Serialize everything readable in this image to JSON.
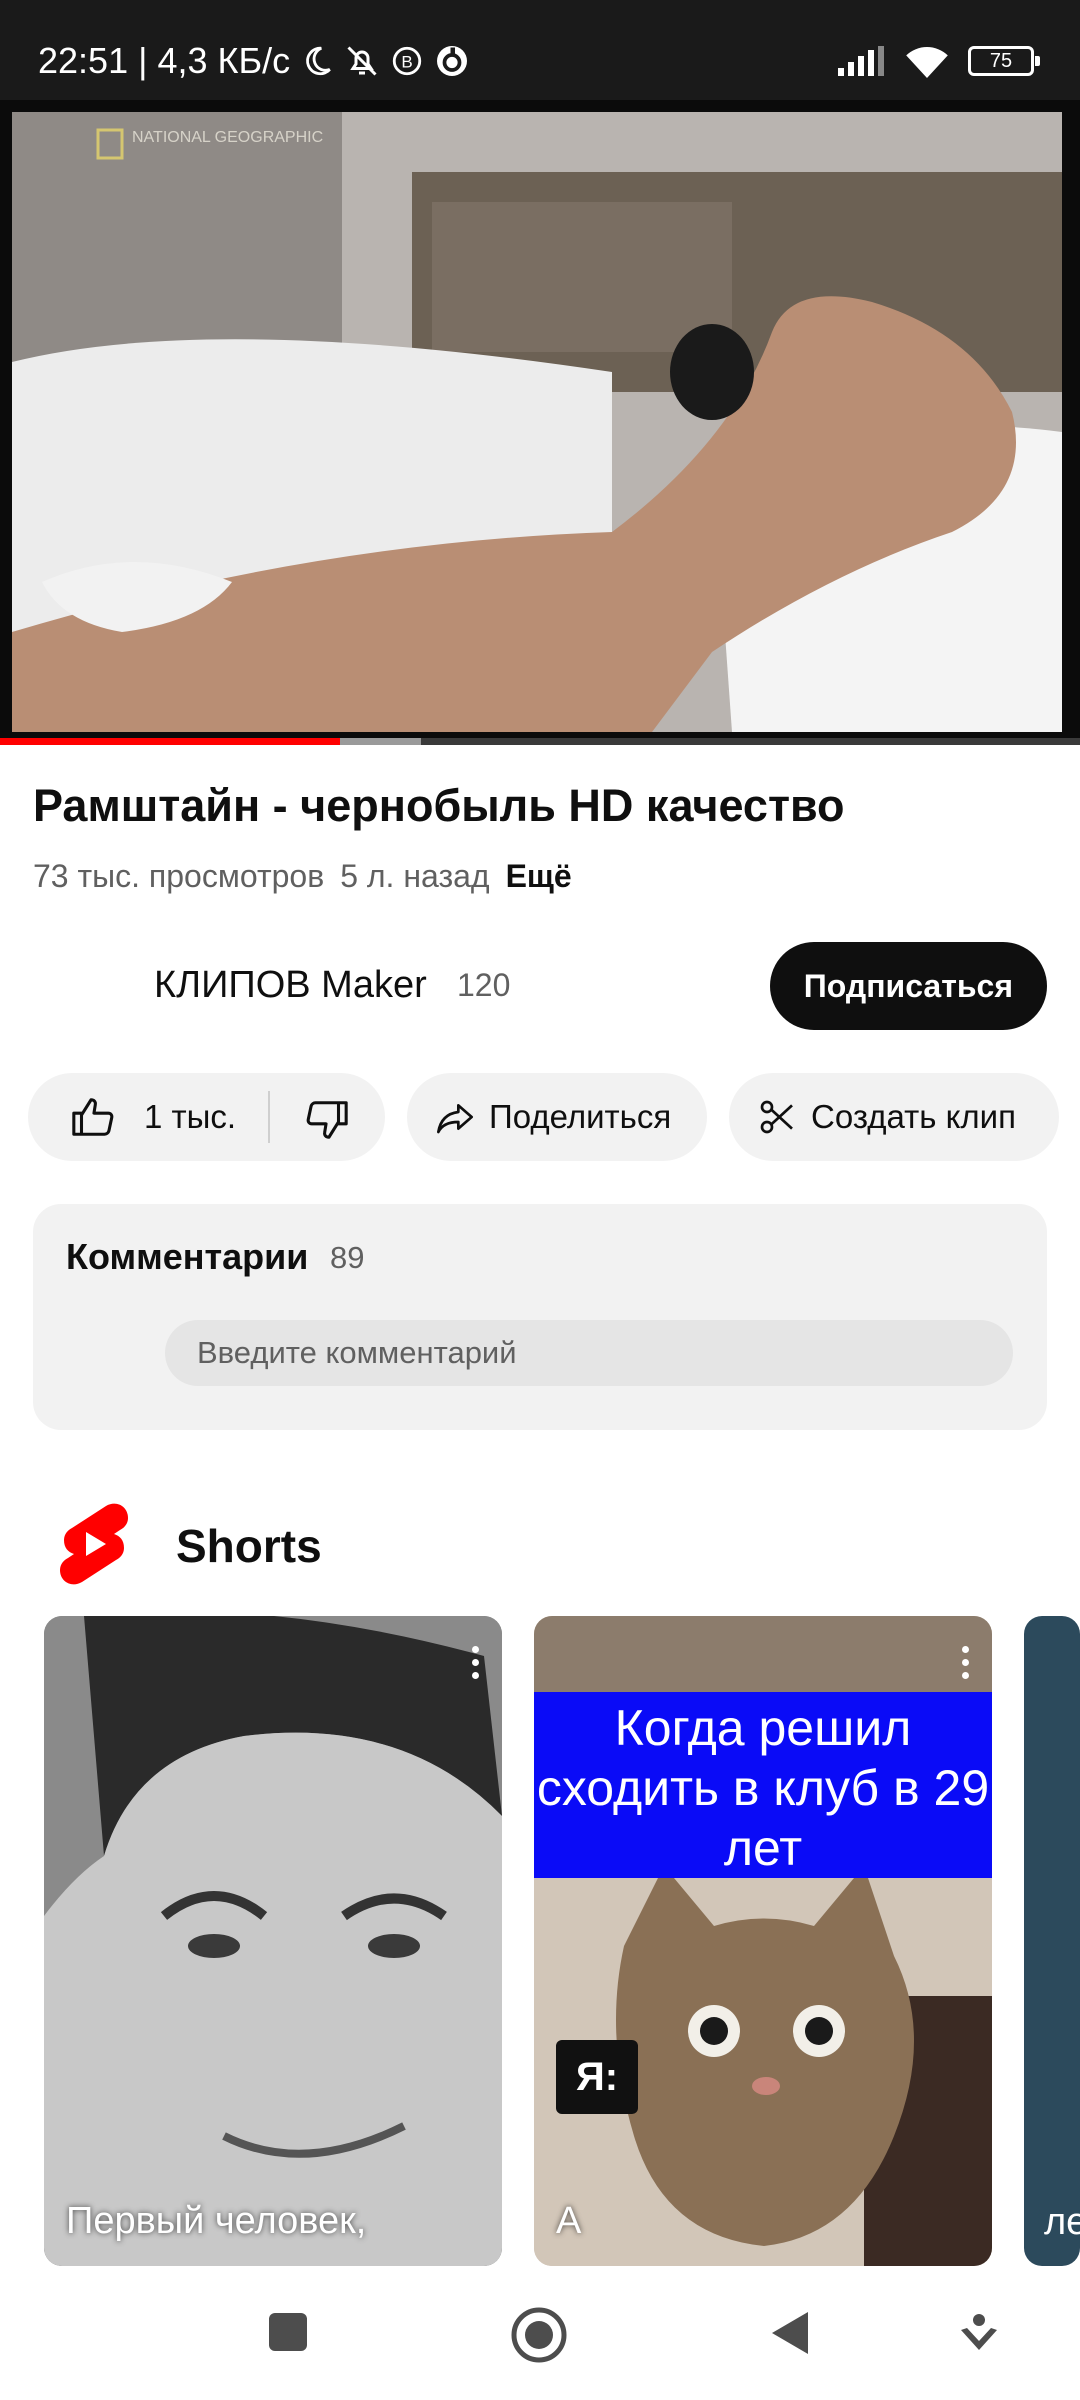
{
  "status_bar": {
    "time": "22:51",
    "network_speed": "| 4,3 КБ/с",
    "battery": "75",
    "icons": [
      "moon-icon",
      "bell-off-icon",
      "b-circle-icon",
      "sync-icon",
      "signal-icon",
      "wifi-icon",
      "battery-icon"
    ]
  },
  "video": {
    "watermark": "NATIONAL GEOGRAPHIC",
    "progress_played": 0.315,
    "progress_buffered": 0.39
  },
  "video_info": {
    "title": "Рамштайн - чернобыль HD качество",
    "views": "73 тыс. просмотров",
    "age": "5 л. назад",
    "more": "Ещё"
  },
  "channel": {
    "name": "КЛИПОВ Maker",
    "subscribers": "120",
    "subscribe_label": "Подписаться"
  },
  "actions": {
    "likes": "1 тыс.",
    "share": "Поделиться",
    "clip": "Создать клип"
  },
  "comments": {
    "title": "Комментарии",
    "count": "89",
    "placeholder": "Введите комментарий"
  },
  "shorts": {
    "title": "Shorts",
    "brand_color": "#ff0000",
    "items": [
      {
        "caption": "Первый человек,"
      },
      {
        "banner": "Когда решил сходить в клуб в 29 лет",
        "overlay": "Я:",
        "caption": "А"
      },
      {
        "caption": "ле"
      }
    ]
  },
  "nav": {
    "buttons": [
      "recents-square-icon",
      "home-circle-icon",
      "back-triangle-icon",
      "assistant-down-icon"
    ]
  }
}
